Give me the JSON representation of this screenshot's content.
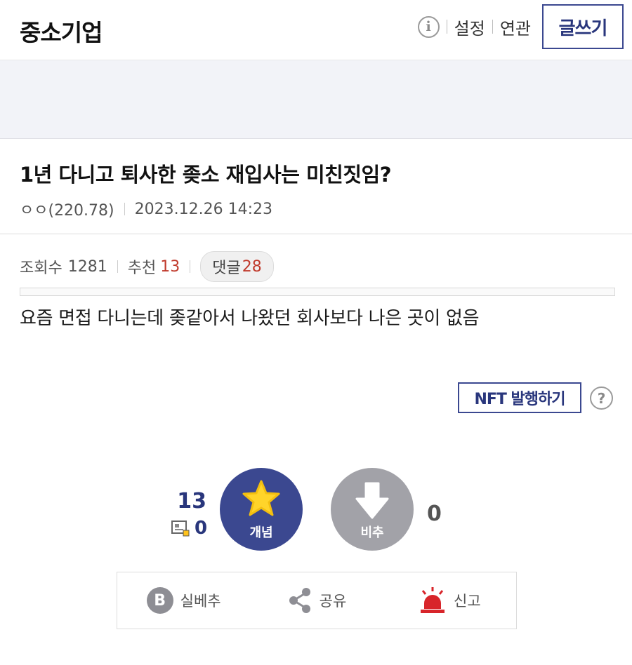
{
  "header": {
    "gallery_title": "중소기업",
    "info_icon": "info-icon",
    "settings_label": "설정",
    "related_label": "연관",
    "write_label": "글쓰기"
  },
  "post": {
    "title": "1년 다니고 퇴사한 좆소 재입사는 미친짓임?",
    "author": "ㅇㅇ(220.78)",
    "datetime": "2023.12.26 14:23",
    "views_label": "조회수",
    "views": "1281",
    "recommend_label": "추천",
    "recommend": "13",
    "comments_label": "댓글",
    "comments": "28",
    "body": "요즘 면접 다니는데 좆같아서 나왔던 회사보다 나은 곳이 없음"
  },
  "nft": {
    "button_label": "NFT 발행하기",
    "help_icon": "question-icon"
  },
  "vote": {
    "up_count": "13",
    "fix_count": "0",
    "up_label": "개념",
    "down_label": "비추",
    "down_count": "0"
  },
  "actions": {
    "best_icon_letter": "B",
    "best_label": "실베추",
    "share_label": "공유",
    "report_label": "신고"
  },
  "colors": {
    "accent": "#3b4890",
    "accent_text": "#29367c",
    "red": "#c0392b",
    "star": "#ffd42a",
    "downvote_gray": "#a2a2a8",
    "siren_red": "#d8252a"
  }
}
